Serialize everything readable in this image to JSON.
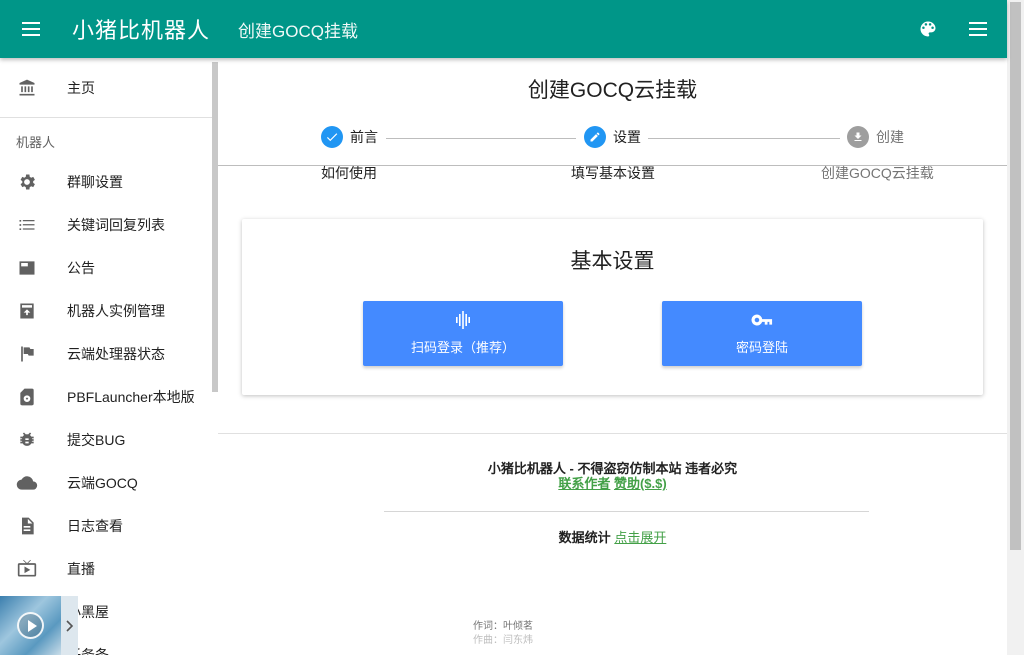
{
  "appbar": {
    "brand": "小猪比机器人",
    "subtitle": "创建GOCQ挂载",
    "color": "#009688"
  },
  "sidebar": {
    "home": "主页",
    "section": "机器人",
    "items": [
      {
        "label": "群聊设置",
        "icon": "gear-icon"
      },
      {
        "label": "关键词回复列表",
        "icon": "list-icon"
      },
      {
        "label": "公告",
        "icon": "announcement-icon"
      },
      {
        "label": "机器人实例管理",
        "icon": "archive-icon"
      },
      {
        "label": "云端处理器状态",
        "icon": "flag-icon"
      },
      {
        "label": "PBFLauncher本地版",
        "icon": "sd-card-icon"
      },
      {
        "label": "提交BUG",
        "icon": "bug-icon"
      },
      {
        "label": "云端GOCQ",
        "icon": "cloud-icon"
      },
      {
        "label": "日志查看",
        "icon": "document-icon"
      },
      {
        "label": "直播",
        "icon": "tv-icon"
      },
      {
        "label": "小黑屋",
        "icon": "box-icon"
      },
      {
        "label": "任务条",
        "icon": "task-icon"
      }
    ]
  },
  "main": {
    "title": "创建GOCQ云挂载",
    "steps": [
      {
        "label": "前言",
        "sub": "如何使用",
        "state": "done"
      },
      {
        "label": "设置",
        "sub": "填写基本设置",
        "state": "active"
      },
      {
        "label": "创建",
        "sub": "创建GOCQ云挂载",
        "state": "pending"
      }
    ],
    "card": {
      "title": "基本设置",
      "scan_button": "扫码登录（推荐）",
      "password_button": "密码登陆"
    }
  },
  "footer": {
    "notice": "小猪比机器人 - 不得盗窃仿制本站 违者必究",
    "contact_link": "联系作者",
    "sponsor_link": "赞助($.$)",
    "stats_label": "数据统计",
    "stats_link": "点击展开",
    "lyric_1": "作词：叶倾茗",
    "lyric_2": "作曲：闫东炜"
  },
  "colors": {
    "accent": "#009688",
    "button": "#448aff",
    "step_done": "#2196f3",
    "link": "#43a047"
  }
}
